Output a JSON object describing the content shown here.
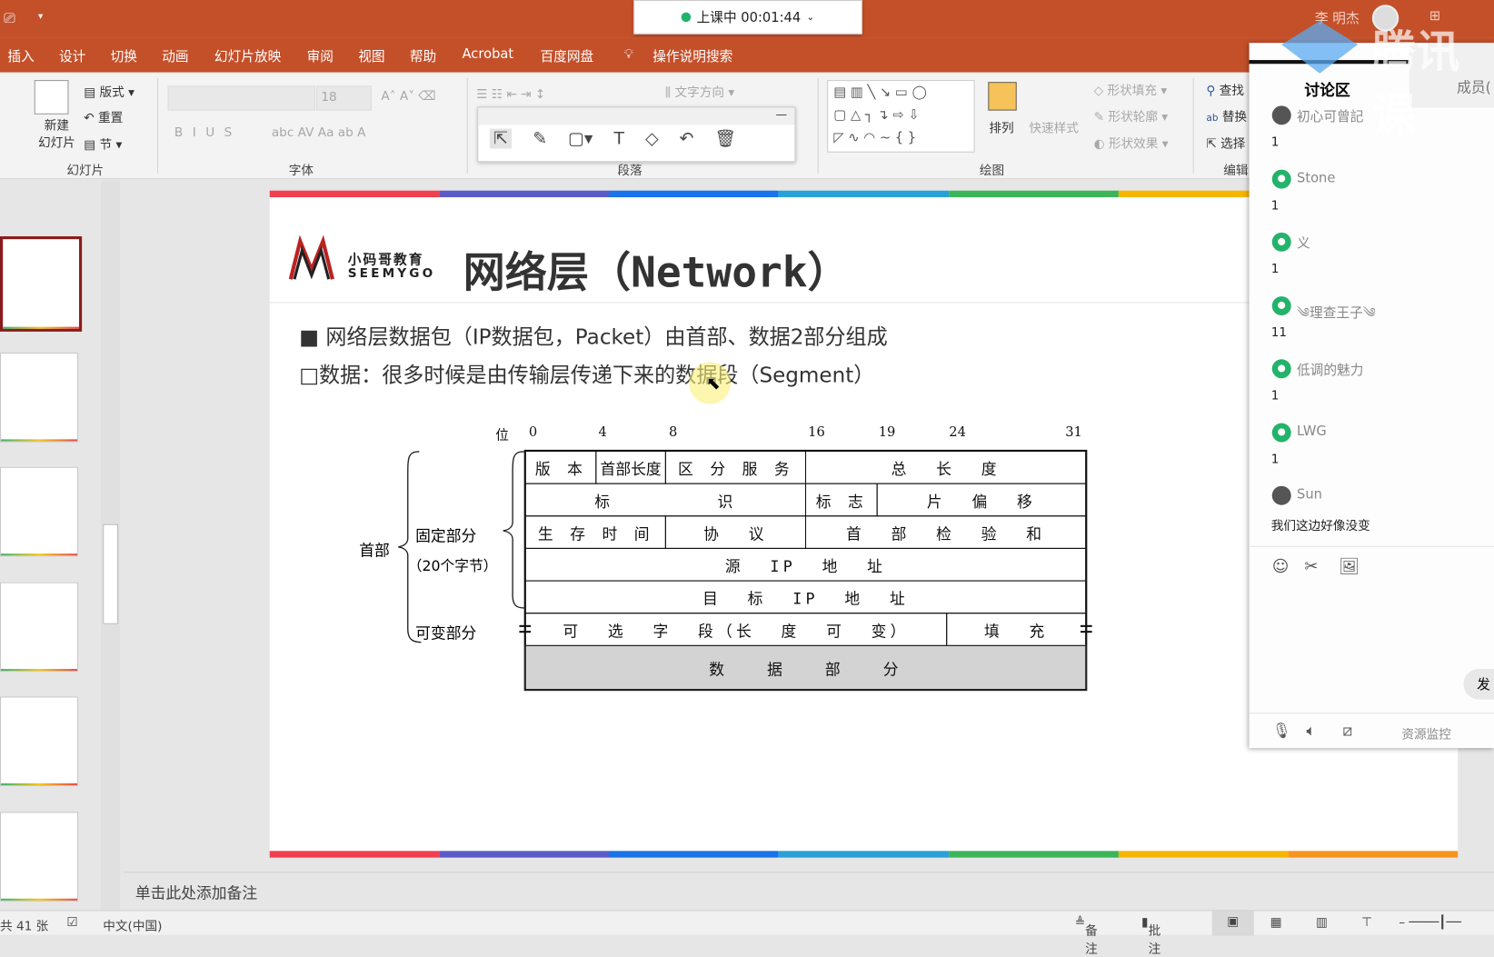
{
  "titlebar": {
    "user": "李 明杰",
    "timer": "上课中 00:01:44",
    "watermark": "腾讯课"
  },
  "tabs": [
    "插入",
    "设计",
    "切换",
    "动画",
    "幻灯片放映",
    "审阅",
    "视图",
    "帮助",
    "Acrobat",
    "百度网盘",
    "操作说明搜索"
  ],
  "ribbon": {
    "slides": {
      "new_slide": "新建\n幻灯片",
      "layout": "版式",
      "reset": "重置",
      "section": "节",
      "label": "幻灯片"
    },
    "font": {
      "size": "18",
      "label": "字体"
    },
    "paragraph": {
      "text_direction": "文字方向",
      "label": "段落"
    },
    "drawing": {
      "arrange": "排列",
      "quick_styles": "快速样式",
      "shape_fill": "形状填充",
      "shape_outline": "形状轮廓",
      "shape_effects": "形状效果",
      "label": "绘图"
    },
    "editing": {
      "find": "查找",
      "replace": "替换",
      "select": "选择",
      "label": "编辑"
    }
  },
  "slide": {
    "logo_cn": "小码哥教育",
    "logo_en": "SEEMYGO",
    "title": "网络层（Network）",
    "bullet1": "网络层数据包（IP数据包，Packet）由首部、数据2部分组成",
    "bullet2": "数据：很多时候是由传输层传递下来的数据段（Segment）",
    "diagram": {
      "bit_label": "位",
      "bits": [
        "0",
        "4",
        "8",
        "16",
        "19",
        "24",
        "31"
      ],
      "header": "首部",
      "fixed": "固定部分",
      "fixed_size": "（20个字节）",
      "variable": "可变部分",
      "fields": {
        "version": "版 本",
        "ihl": "首部长度",
        "dsf": "区 分 服 务",
        "total_length": "总  长  度",
        "identification": "标        识",
        "flags": "标 志",
        "fragment_offset": "片  偏  移",
        "ttl": "生 存 时 间",
        "protocol": "协  议",
        "checksum": "首  部  检  验  和",
        "src": "源  IP  地  址",
        "dst": "目  标  IP  地  址",
        "options": "可  选  字  段（长  度  可  变）",
        "padding": "填  充",
        "data": "数   据   部   分"
      }
    }
  },
  "notes_placeholder": "单击此处添加备注",
  "status": {
    "slide_count": "共 41 张",
    "language": "中文(中国)",
    "notes": "备注",
    "comments": "批注"
  },
  "chat": {
    "tab_discussion": "讨论区",
    "tab_members": "成员(",
    "messages": [
      {
        "name": "初心可曾記",
        "text": "1"
      },
      {
        "name": "Stone",
        "text": "1"
      },
      {
        "name": "义",
        "text": "1"
      },
      {
        "name": "༄理查王子༄",
        "text": "11"
      },
      {
        "name": "低调的魅力",
        "text": "1"
      },
      {
        "name": "LWG",
        "text": "1"
      },
      {
        "name": "Sun",
        "text": "我们这边好像没变"
      }
    ],
    "send": "发",
    "resource_monitor": "资源监控"
  },
  "colors": {
    "accent": "#c4502a",
    "rainbow": [
      "#f0404f",
      "#5b5bc7",
      "#1a73e8",
      "#2aa0d8",
      "#3cb45a",
      "#f7b500",
      "#f7941d"
    ]
  }
}
